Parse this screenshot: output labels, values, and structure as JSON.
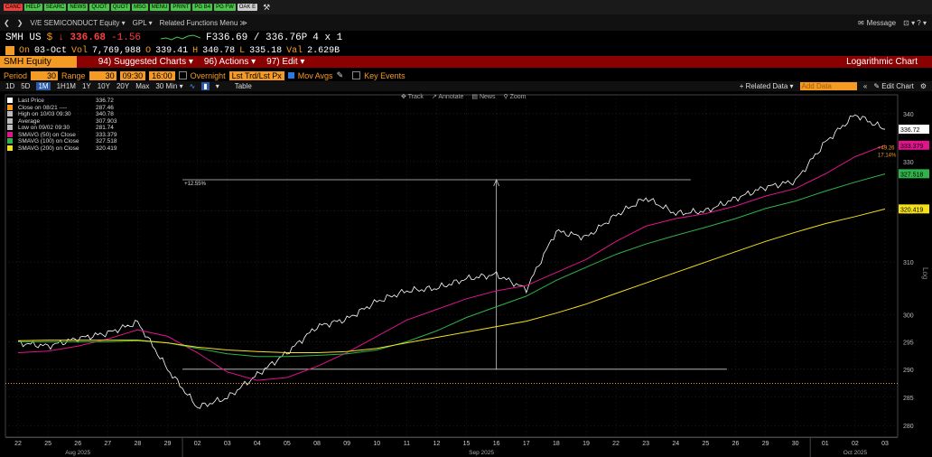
{
  "topbar": {
    "buttons": [
      {
        "label": "CANC",
        "color": "#e8433c"
      },
      {
        "label": "HELP",
        "color": "#4cc44c"
      },
      {
        "label": "SEARC",
        "color": "#4cc44c"
      },
      {
        "label": "NEWS",
        "color": "#4cc44c"
      },
      {
        "label": "QUOT",
        "color": "#4cc44c"
      },
      {
        "label": "QUOT",
        "color": "#4cc44c"
      },
      {
        "label": "MSG",
        "color": "#4cc44c"
      },
      {
        "label": "MENU",
        "color": "#4cc44c"
      },
      {
        "label": "PRINT",
        "color": "#4cc44c"
      },
      {
        "label": "PG B4",
        "color": "#4cc44c"
      },
      {
        "label": "PG FW",
        "color": "#4cc44c"
      },
      {
        "label": "OAK E",
        "color": "#cccccc"
      }
    ]
  },
  "nav": {
    "title": "V/E SEMICONDUCT Equity ▾",
    "gpl": "GPL ▾",
    "related": "Related Functions Menu ≫",
    "message": "Message",
    "right_icons": "⊡ ▾  ? ▾"
  },
  "quote": {
    "ticker": "SMH US",
    "currency": "$",
    "last": "↓ 336.68",
    "change": "-1.56",
    "bid_ask": "F336.69 / 336.76P",
    "size": "4 x 1",
    "line2_prefix": "On",
    "date": "03-Oct",
    "vol_label": "Vol",
    "vol": "7,769,988",
    "o_label": "O",
    "open": "339.41",
    "h_label": "H",
    "high": "340.78",
    "l_label": "L",
    "low": "335.18",
    "val_label": "Val",
    "val": "2.629B"
  },
  "redbar": {
    "title": "SMH Equity",
    "suggested": "94) Suggested Charts ▾",
    "actions": "96) Actions ▾",
    "edit": "97) Edit ▾",
    "right": "Logarithmic Chart"
  },
  "optbar": {
    "period_label": "Period",
    "period_val": "30",
    "range_label": "Range",
    "range_val": "30",
    "time1": "09:30",
    "time2": "16:00",
    "overnight": "Overnight",
    "lst": "Lst Trd/Lst Px",
    "mov_avgs": "Mov Avgs",
    "key_events": "Key Events"
  },
  "periodbar": {
    "items": [
      "1D",
      "5D",
      "1M",
      "1H1M",
      "1Y",
      "10Y",
      "20Y",
      "Max"
    ],
    "active": "1M",
    "interval": "30 Min ▾",
    "table": "Table",
    "related": "+ Related Data ▾",
    "add_data": "Add Data",
    "edit_chart": "✎ Edit Chart"
  },
  "tools": {
    "track": "Track",
    "annotate": "Annotate",
    "news": "News",
    "zoom": "Zoom"
  },
  "legend": [
    {
      "label": "Last Price",
      "value": "336.72",
      "color": "#ffffff"
    },
    {
      "label": "Close on 08/21 ----",
      "value": "287.46",
      "color": "#f59a23"
    },
    {
      "label": "High on 10/03 09:30",
      "value": "340.78",
      "color": "#bbbbbb"
    },
    {
      "label": "Average",
      "value": "307.903",
      "color": "#bbbbbb"
    },
    {
      "label": "Low on 09/02 09:30",
      "value": "281.74",
      "color": "#bbbbbb"
    },
    {
      "label": "SMAVG (50)  on Close",
      "value": "333.379",
      "color": "#e0148c"
    },
    {
      "label": "SMAVG (100)  on Close",
      "value": "327.518",
      "color": "#2fb34a"
    },
    {
      "label": "SMAVG (200)  on Close",
      "value": "320.419",
      "color": "#f4e01b"
    }
  ],
  "chart_data": {
    "type": "line",
    "scale": "log",
    "ylim": [
      278,
      344
    ],
    "yticks": [
      280,
      285,
      290,
      295,
      300,
      310,
      320,
      330,
      340
    ],
    "xlabels": [
      "22",
      "25",
      "26",
      "27",
      "28",
      "29",
      "02",
      "03",
      "04",
      "05",
      "08",
      "09",
      "10",
      "11",
      "12",
      "15",
      "16",
      "17",
      "18",
      "19",
      "22",
      "23",
      "24",
      "25",
      "26",
      "29",
      "30",
      "01",
      "02",
      "03"
    ],
    "months": [
      "Aug 2025",
      "Sep 2025",
      "Oct 2025"
    ],
    "series": [
      {
        "name": "Last Price",
        "color": "#ffffff",
        "values": [
          294.8,
          294.2,
          295.6,
          296.6,
          298.6,
          290.0,
          283.2,
          284.9,
          289.0,
          293.0,
          297.8,
          299.2,
          302.5,
          304.5,
          305.0,
          306.8,
          307.6,
          304.8,
          316.0,
          314.8,
          319.2,
          322.6,
          319.5,
          320.0,
          322.5,
          324.8,
          326.0,
          334.0,
          339.8,
          336.7
        ]
      },
      {
        "name": "SMAVG (50)",
        "color": "#e0148c",
        "values": [
          293.0,
          293.3,
          294.2,
          295.5,
          297.2,
          296.0,
          293.0,
          289.5,
          288.0,
          288.5,
          290.5,
          293.0,
          296.0,
          299.0,
          301.0,
          303.0,
          304.5,
          305.5,
          308.0,
          310.5,
          314.0,
          317.0,
          318.5,
          319.5,
          321.0,
          323.0,
          324.5,
          327.5,
          331.0,
          333.4
        ]
      },
      {
        "name": "SMAVG (100)",
        "color": "#2fb34a",
        "values": [
          295.0,
          295.0,
          295.0,
          295.0,
          295.2,
          294.8,
          293.8,
          292.8,
          292.3,
          292.3,
          292.5,
          292.8,
          293.5,
          295.0,
          297.0,
          299.5,
          301.5,
          303.5,
          306.5,
          309.0,
          311.5,
          313.5,
          315.2,
          316.8,
          318.5,
          320.5,
          322.0,
          324.0,
          325.8,
          327.5
        ]
      },
      {
        "name": "SMAVG (200)",
        "color": "#f4e01b",
        "values": [
          295.2,
          295.3,
          295.3,
          295.3,
          295.3,
          294.8,
          294.0,
          293.5,
          293.2,
          293.0,
          293.0,
          293.2,
          293.8,
          294.8,
          295.8,
          296.8,
          297.8,
          298.8,
          300.3,
          302.0,
          304.0,
          306.0,
          308.0,
          310.0,
          312.0,
          314.0,
          315.8,
          317.5,
          318.9,
          320.4
        ]
      }
    ],
    "ref_line": {
      "label": "Close on 08/21",
      "value": 287.46,
      "color": "#f59a23"
    },
    "annotation": {
      "text": "+12.55%",
      "from": 290.0,
      "to": 326.3
    },
    "right_labels": [
      {
        "text": "336.72",
        "color": "#ffffff",
        "value": 336.72
      },
      {
        "text": "333.379",
        "color": "#e0148c",
        "value": 333.379
      },
      {
        "text": "327.518",
        "color": "#2fb34a",
        "value": 327.518
      },
      {
        "text": "320.419",
        "color": "#f4e01b",
        "value": 320.419
      }
    ],
    "side_note": [
      "+49.26",
      "17.14%"
    ],
    "axis_caption": "Log"
  }
}
